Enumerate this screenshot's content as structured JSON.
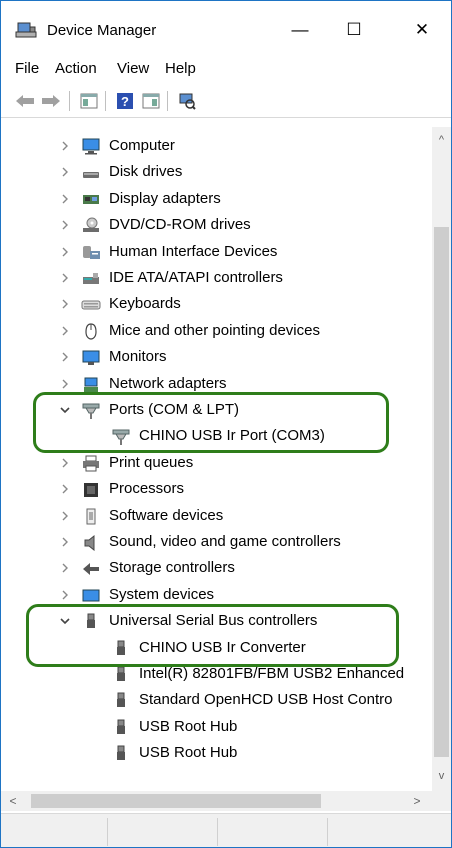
{
  "window": {
    "title": "Device Manager",
    "minimize": "—",
    "maximize": "☐",
    "close": "✕"
  },
  "menu": [
    "File",
    "Action",
    "View",
    "Help"
  ],
  "tree": [
    {
      "label": "Computer",
      "icon": "computer-icon",
      "expanded": false
    },
    {
      "label": "Disk drives",
      "icon": "disk-drive-icon",
      "expanded": false
    },
    {
      "label": "Display adapters",
      "icon": "display-adapter-icon",
      "expanded": false
    },
    {
      "label": "DVD/CD-ROM drives",
      "icon": "dvd-drive-icon",
      "expanded": false
    },
    {
      "label": "Human Interface Devices",
      "icon": "hid-icon",
      "expanded": false
    },
    {
      "label": "IDE ATA/ATAPI controllers",
      "icon": "ide-controller-icon",
      "expanded": false
    },
    {
      "label": "Keyboards",
      "icon": "keyboard-icon",
      "expanded": false
    },
    {
      "label": "Mice and other pointing devices",
      "icon": "mouse-icon",
      "expanded": false
    },
    {
      "label": "Monitors",
      "icon": "monitor-icon",
      "expanded": false
    },
    {
      "label": "Network adapters",
      "icon": "network-adapter-icon",
      "expanded": false
    },
    {
      "label": "Ports (COM & LPT)",
      "icon": "port-icon",
      "expanded": true,
      "children": [
        {
          "label": "CHINO USB Ir Port (COM3)",
          "icon": "port-icon"
        }
      ]
    },
    {
      "label": "Print queues",
      "icon": "printer-icon",
      "expanded": false
    },
    {
      "label": "Processors",
      "icon": "processor-icon",
      "expanded": false
    },
    {
      "label": "Software devices",
      "icon": "software-device-icon",
      "expanded": false
    },
    {
      "label": "Sound, video and game controllers",
      "icon": "speaker-icon",
      "expanded": false
    },
    {
      "label": "Storage controllers",
      "icon": "storage-controller-icon",
      "expanded": false
    },
    {
      "label": "System devices",
      "icon": "system-device-icon",
      "expanded": false
    },
    {
      "label": "Universal Serial Bus controllers",
      "icon": "usb-icon",
      "expanded": true,
      "children": [
        {
          "label": "CHINO USB Ir Converter",
          "icon": "usb-icon"
        },
        {
          "label": "Intel(R) 82801FB/FBM USB2 Enhanced",
          "icon": "usb-icon"
        },
        {
          "label": "Standard OpenHCD USB Host Contro",
          "icon": "usb-icon"
        },
        {
          "label": "USB Root Hub",
          "icon": "usb-icon"
        },
        {
          "label": "USB Root Hub",
          "icon": "usb-icon"
        }
      ]
    }
  ],
  "colors": {
    "highlight_border": "#2e7d1a",
    "window_border": "#1e74c4"
  }
}
